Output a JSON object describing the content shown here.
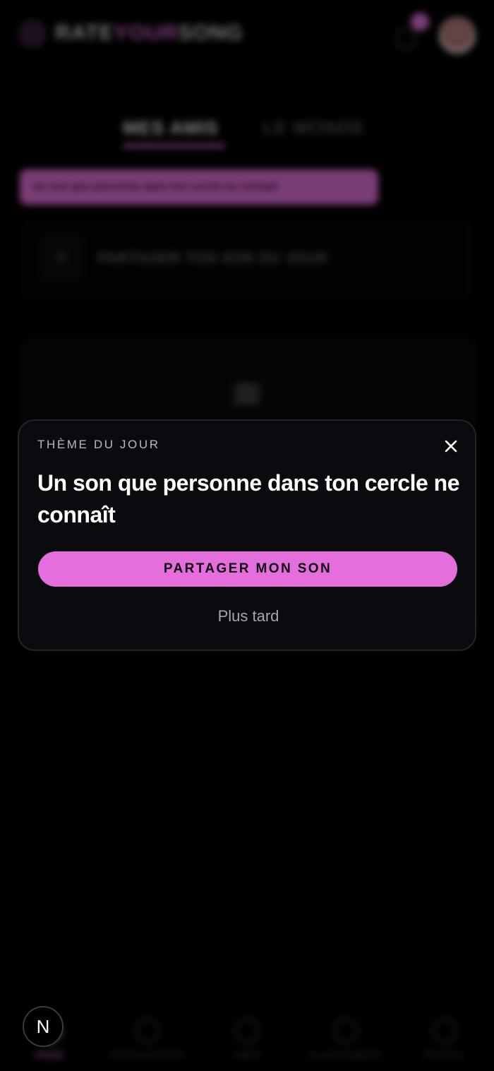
{
  "background": {
    "logo": {
      "part1": "RATE",
      "part2": "YOUR",
      "part3": "SONG"
    },
    "tabs": [
      {
        "label": "MES AMIS"
      },
      {
        "label": "LE MONDE"
      }
    ],
    "banner_text": "Un son que personne dans ton cercle ne connaît",
    "share_card": {
      "plus": "+",
      "label": "PARTAGER TON SON DU JOUR"
    },
    "bottom_nav": [
      {
        "label": "FEED"
      },
      {
        "label": "DÉCOUVERTE"
      },
      {
        "label": "AMIS"
      },
      {
        "label": "CLASSEMENT"
      },
      {
        "label": "PROFIL"
      }
    ]
  },
  "modal": {
    "eyebrow": "THÈME DU JOUR",
    "title": "Un son que personne dans ton cercle ne connaît",
    "primary_label": "PARTAGER MON SON",
    "secondary_label": "Plus tard"
  },
  "dev_badge": {
    "label": "N"
  },
  "colors": {
    "accent": "#e46fdc",
    "modal_bg": "#0a0b0e",
    "page_bg": "#000000"
  }
}
